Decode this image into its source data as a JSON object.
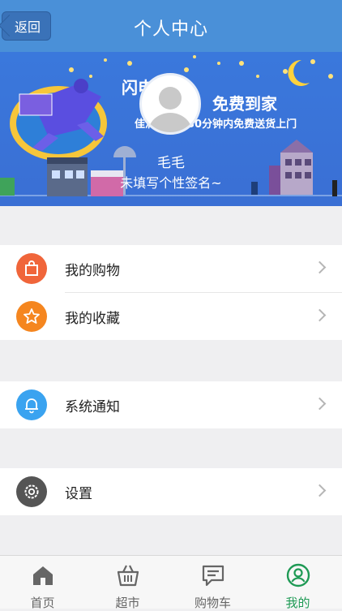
{
  "header": {
    "back_label": "返回",
    "title": "个人中心"
  },
  "banner": {
    "slogan_line1": "闪电送货",
    "slogan_line2": "免费到家",
    "slogan_line3": "佳满快选：30分钟内免费送货上门",
    "sticker_text": "佳满快选"
  },
  "profile": {
    "username": "毛毛",
    "signature": "未填写个性签名~"
  },
  "menu": {
    "group1": [
      {
        "label": "我的购物",
        "icon": "shopping-bag-icon",
        "color": "#f0653a"
      },
      {
        "label": "我的收藏",
        "icon": "star-icon",
        "color": "#f5861f"
      }
    ],
    "group2": [
      {
        "label": "系统通知",
        "icon": "bell-icon",
        "color": "#3aa3f0"
      }
    ],
    "group3": [
      {
        "label": "设置",
        "icon": "settings-gear-icon",
        "color": "#555555"
      }
    ]
  },
  "tabbar": {
    "tabs": [
      {
        "label": "首页",
        "icon": "home-icon",
        "active": false
      },
      {
        "label": "超市",
        "icon": "basket-icon",
        "active": false
      },
      {
        "label": "购物车",
        "icon": "chat-cart-icon",
        "active": false
      },
      {
        "label": "我的",
        "icon": "user-icon",
        "active": true
      }
    ],
    "active_color": "#1f9a55",
    "inactive_color": "#666666"
  },
  "colors": {
    "header": "#4a90d8",
    "banner": "#3a72d8",
    "background": "#efeff1"
  }
}
